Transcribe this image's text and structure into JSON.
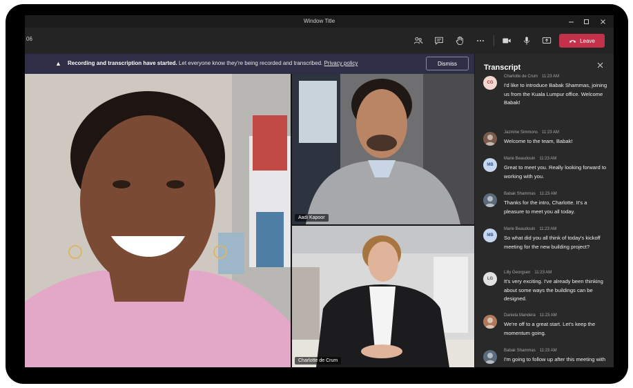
{
  "window": {
    "title": "Window Title"
  },
  "toolbar": {
    "timer": "06",
    "leave_label": "Leave",
    "icons": [
      "people-icon",
      "chat-icon",
      "raise-hand-icon",
      "more-icon",
      "camera-icon",
      "mic-icon",
      "share-icon"
    ]
  },
  "banner": {
    "bold_text": "Recording and transcription have started.",
    "text": " Let everyone know they're being recorded and transcribed. ",
    "link": "Privacy policy",
    "dismiss_label": "Dismiss"
  },
  "participants": [
    {
      "name": ""
    },
    {
      "name": "Aadi Kapoor"
    },
    {
      "name": "Charlotte de Crum"
    }
  ],
  "transcript": {
    "title": "Transcript",
    "entries": [
      {
        "initials": "CG",
        "avatar_bg": "#f3d7d1",
        "avatar_fg": "#a4373a",
        "name": "Charlotte de Crum",
        "time": "11:23 AM",
        "text": "I'd like to introduce Babak Shammas, joining us from the Kuala Lumpur office. Welcome Babak!"
      },
      {
        "initials": "",
        "avatar_bg": "#7a5a4a",
        "avatar_fg": "#fff",
        "name": "Jazmine Simmons",
        "time": "11:23 AM",
        "text": "Welcome to the team, Babak!"
      },
      {
        "initials": "MB",
        "avatar_bg": "#c7d7ef",
        "avatar_fg": "#2f5496",
        "name": "Marie Beaudouin",
        "time": "11:23 AM",
        "text": "Great to meet you. Really looking forward to working with you."
      },
      {
        "initials": "",
        "avatar_bg": "#5b6b7b",
        "avatar_fg": "#fff",
        "name": "Babak Shammas",
        "time": "11:23 AM",
        "text": "Thanks for the intro, Charlotte. It's a pleasure to meet you all today."
      },
      {
        "initials": "MB",
        "avatar_bg": "#c7d7ef",
        "avatar_fg": "#2f5496",
        "name": "Marie Beaudouin",
        "time": "11:23 AM",
        "text": "So what did you all think of today's kickoff meeting for the new building project?"
      },
      {
        "initials": "LG",
        "avatar_bg": "#e1e1e1",
        "avatar_fg": "#555",
        "name": "Lilly Georgsen",
        "time": "11:23 AM",
        "text": "It's very exciting. I've already been thinking about some ways the buildings can be designed."
      },
      {
        "initials": "",
        "avatar_bg": "#b07a5a",
        "avatar_fg": "#fff",
        "name": "Daniela Mandera",
        "time": "11:23 AM",
        "text": "We're off to a great start. Let's keep the momentum going."
      },
      {
        "initials": "",
        "avatar_bg": "#5b6b7b",
        "avatar_fg": "#fff",
        "name": "Babak Shammas",
        "time": "11:23 AM",
        "text": "I'm going to follow up after this meeting with"
      }
    ]
  }
}
